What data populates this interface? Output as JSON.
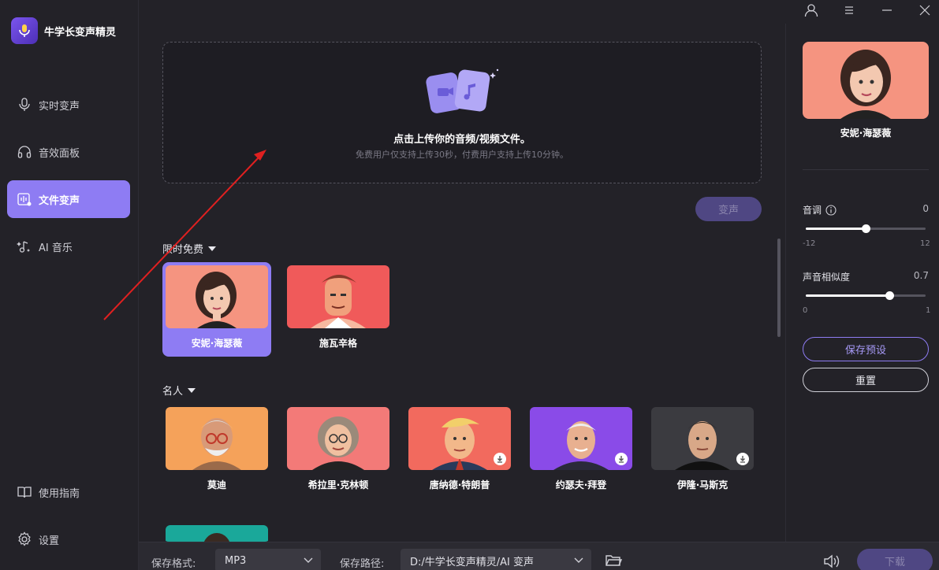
{
  "app": {
    "name": "牛学长变声精灵"
  },
  "sidebar": {
    "items": [
      {
        "label": "实时变声",
        "icon": "microphone-icon",
        "active": false
      },
      {
        "label": "音效面板",
        "icon": "headphones-icon",
        "active": false
      },
      {
        "label": "文件变声",
        "icon": "file-audio-icon",
        "active": true
      },
      {
        "label": "AI 音乐",
        "icon": "music-sparkle-icon",
        "active": false
      }
    ],
    "bottom": [
      {
        "label": "使用指南",
        "icon": "book-icon"
      },
      {
        "label": "设置",
        "icon": "gear-icon"
      }
    ]
  },
  "upload": {
    "title": "点击上传你的音频/视频文件。",
    "subtitle": "免费用户仅支持上传30秒，付费用户支持上传10分钟。"
  },
  "convert_label": "变声",
  "sections": [
    {
      "title": "限时免费",
      "voices": [
        {
          "name": "安妮·海瑟薇",
          "selected": true,
          "download": false,
          "bg": "#f59480"
        },
        {
          "name": "施瓦辛格",
          "selected": false,
          "download": false,
          "bg": "#f05a5a"
        }
      ]
    },
    {
      "title": "名人",
      "voices": [
        {
          "name": "莫迪",
          "download": false,
          "bg": "#f5a25a"
        },
        {
          "name": "希拉里·克林顿",
          "download": false,
          "bg": "#f37a78"
        },
        {
          "name": "唐纳德·特朗普",
          "download": true,
          "bg": "#f26a5e"
        },
        {
          "name": "约瑟夫·拜登",
          "download": true,
          "bg": "#8a4be8"
        },
        {
          "name": "伊隆·马斯克",
          "download": true,
          "bg": "#3b3b40"
        }
      ]
    }
  ],
  "right_panel": {
    "selected_name": "安妮·海瑟薇",
    "pitch": {
      "label": "音调",
      "value": "0",
      "min": "-12",
      "max": "12",
      "fraction": 0.5
    },
    "similarity": {
      "label": "声音相似度",
      "value": "0.7",
      "min": "0",
      "max": "1",
      "fraction": 0.7
    },
    "save_preset": "保存预设",
    "reset": "重置",
    "accent": "#8e7cf3"
  },
  "bottom_bar": {
    "format_label": "保存格式:",
    "format_value": "MP3",
    "path_label": "保存路径:",
    "path_value": "D:/牛学长变声精灵/AI 变声",
    "download_label": "下载"
  }
}
